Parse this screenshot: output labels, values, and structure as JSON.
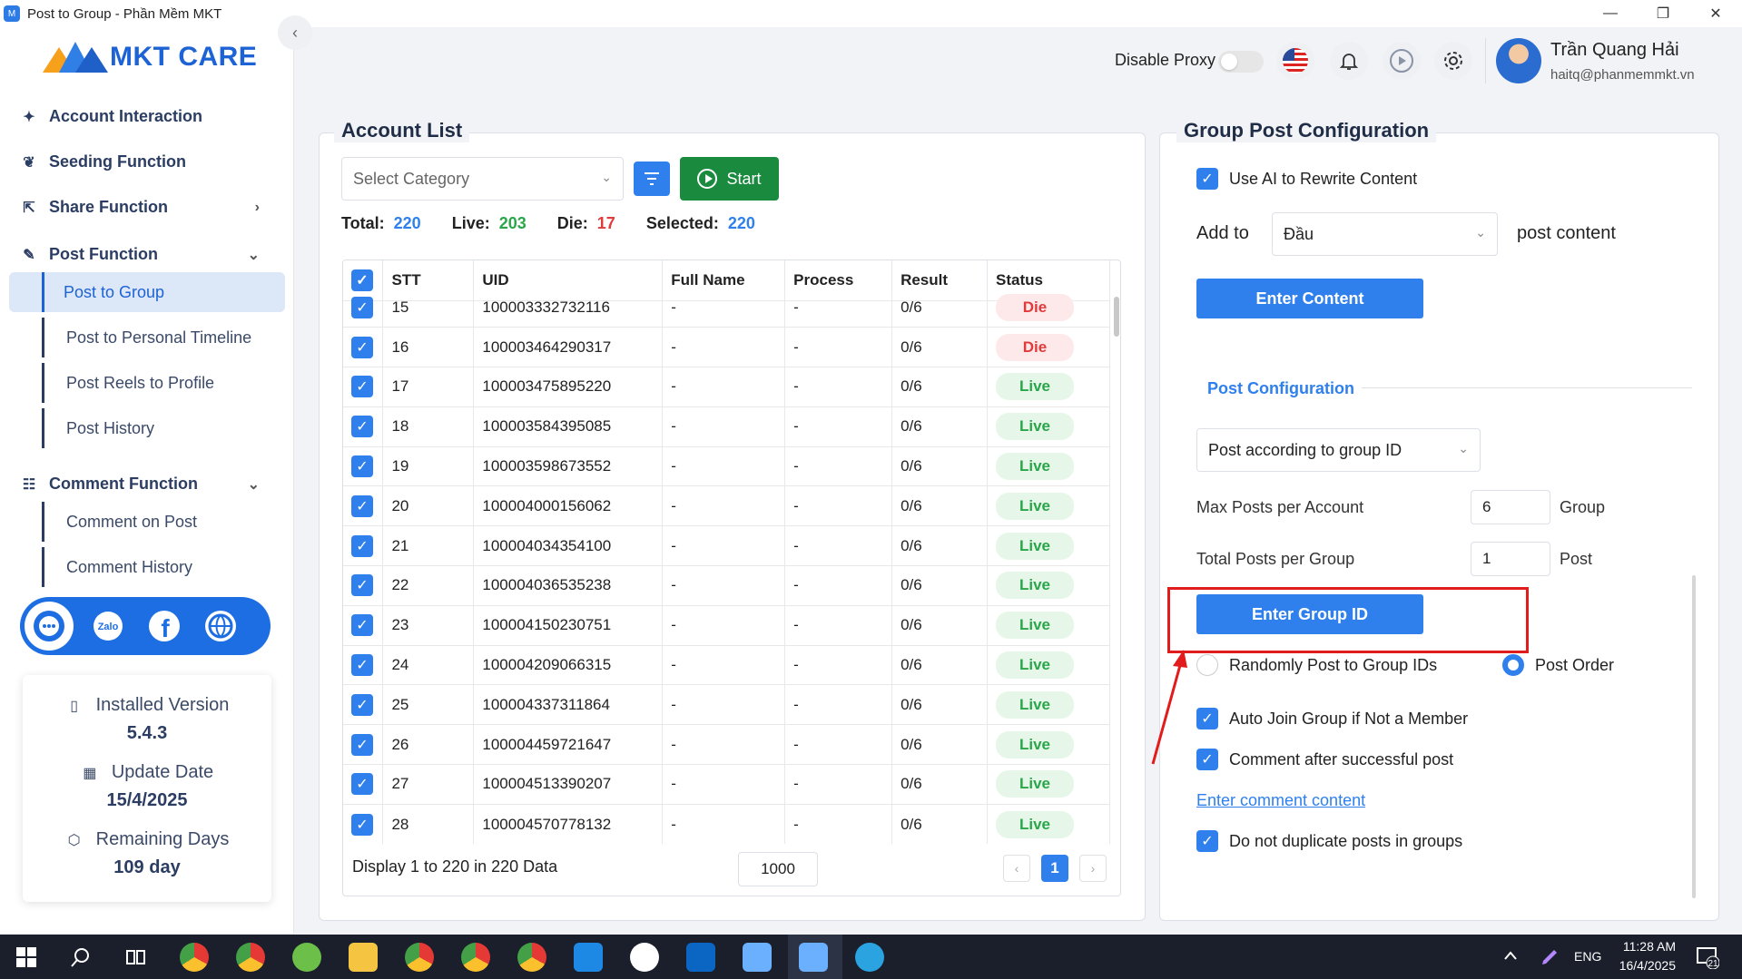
{
  "window": {
    "title": "Post to Group - Phần Mềm MKT",
    "minimize": "—",
    "maximize": "❐",
    "close": "✕",
    "app_icon_text": "M"
  },
  "logo": {
    "text": "MKT CARE"
  },
  "sidebar": {
    "collapse_icon": "‹",
    "items": [
      {
        "label": "Account Interaction",
        "icon": "sparkle-icon",
        "glyph": "✦"
      },
      {
        "label": "Seeding Function",
        "icon": "seed-icon",
        "glyph": "❦"
      },
      {
        "label": "Share Function",
        "icon": "share-icon",
        "glyph": "⇱",
        "chevron": "›"
      },
      {
        "label": "Post Function",
        "icon": "post-icon",
        "glyph": "✎",
        "chevron": "⌄"
      },
      {
        "label": "Comment Function",
        "icon": "comment-icon",
        "glyph": "☷",
        "chevron": "⌄"
      }
    ],
    "post_sub": [
      "Post to Group",
      "Post to Personal Timeline",
      "Post Reels to Profile",
      "Post History"
    ],
    "comment_sub": [
      "Comment on Post",
      "Comment History"
    ],
    "social_icons": [
      "support-icon",
      "zalo-icon",
      "facebook-icon",
      "website-icon"
    ],
    "zalo_text": "Zalo",
    "facebook_text": "f",
    "version": {
      "installed_label": "Installed Version",
      "installed_value": "5.4.3",
      "update_label": "Update Date",
      "update_value": "15/4/2025",
      "remaining_label": "Remaining Days",
      "remaining_value": "109 day"
    }
  },
  "header": {
    "proxy_label": "Disable Proxy",
    "proxy_enabled": false,
    "user_name": "Trần Quang Hải",
    "user_email": "haitq@phanmemmkt.vn"
  },
  "account_list": {
    "title": "Account List",
    "category_placeholder": "Select Category",
    "start_label": "Start",
    "stats": {
      "total_label": "Total:",
      "total": "220",
      "live_label": "Live:",
      "live": "203",
      "die_label": "Die:",
      "die": "17",
      "selected_label": "Selected:",
      "selected": "220"
    },
    "columns": [
      "STT",
      "UID",
      "Full Name",
      "Process",
      "Result",
      "Status"
    ],
    "rows": [
      {
        "stt": "15",
        "uid": "100003332732116",
        "name": "-",
        "process": "-",
        "result": "0/6",
        "status": "Die"
      },
      {
        "stt": "16",
        "uid": "100003464290317",
        "name": "-",
        "process": "-",
        "result": "0/6",
        "status": "Die"
      },
      {
        "stt": "17",
        "uid": "100003475895220",
        "name": "-",
        "process": "-",
        "result": "0/6",
        "status": "Live"
      },
      {
        "stt": "18",
        "uid": "100003584395085",
        "name": "-",
        "process": "-",
        "result": "0/6",
        "status": "Live"
      },
      {
        "stt": "19",
        "uid": "100003598673552",
        "name": "-",
        "process": "-",
        "result": "0/6",
        "status": "Live"
      },
      {
        "stt": "20",
        "uid": "100004000156062",
        "name": "-",
        "process": "-",
        "result": "0/6",
        "status": "Live"
      },
      {
        "stt": "21",
        "uid": "100004034354100",
        "name": "-",
        "process": "-",
        "result": "0/6",
        "status": "Live"
      },
      {
        "stt": "22",
        "uid": "100004036535238",
        "name": "-",
        "process": "-",
        "result": "0/6",
        "status": "Live"
      },
      {
        "stt": "23",
        "uid": "100004150230751",
        "name": "-",
        "process": "-",
        "result": "0/6",
        "status": "Live"
      },
      {
        "stt": "24",
        "uid": "100004209066315",
        "name": "-",
        "process": "-",
        "result": "0/6",
        "status": "Live"
      },
      {
        "stt": "25",
        "uid": "100004337311864",
        "name": "-",
        "process": "-",
        "result": "0/6",
        "status": "Live"
      },
      {
        "stt": "26",
        "uid": "100004459721647",
        "name": "-",
        "process": "-",
        "result": "0/6",
        "status": "Live"
      },
      {
        "stt": "27",
        "uid": "100004513390207",
        "name": "-",
        "process": "-",
        "result": "0/6",
        "status": "Live"
      },
      {
        "stt": "28",
        "uid": "100004570778132",
        "name": "-",
        "process": "-",
        "result": "0/6",
        "status": "Live"
      }
    ],
    "footer_text": "Display 1 to 220 in 220 Data",
    "page_size": "1000",
    "current_page": "1",
    "prev": "‹",
    "next": "›"
  },
  "config": {
    "title": "Group Post Configuration",
    "use_ai_label": "Use AI to Rewrite Content",
    "use_ai_checked": true,
    "add_to_label": "Add to",
    "add_to_value": "Đầu",
    "post_content_label": "post content",
    "enter_content_label": "Enter Content",
    "post_config_label": "Post Configuration",
    "post_mode_value": "Post according to group ID",
    "max_posts_label": "Max Posts per Account",
    "max_posts_value": "6",
    "max_posts_unit": "Group",
    "total_posts_label": "Total Posts per Group",
    "total_posts_value": "1",
    "total_posts_unit": "Post",
    "enter_group_id_label": "Enter Group ID",
    "random_label": "Randomly Post to Group IDs",
    "order_label": "Post Order",
    "selected_mode": "Post Order",
    "auto_join_label": "Auto Join Group if Not a Member",
    "comment_after_label": "Comment after successful post",
    "enter_comment_link": "Enter comment content",
    "no_duplicate_label": "Do not duplicate posts in groups"
  },
  "taskbar": {
    "lang": "ENG",
    "time": "11:28 AM",
    "date": "16/4/2025",
    "notif_count": "21"
  },
  "colors": {
    "accent": "#2f80ed",
    "start_green": "#1a8a3e",
    "live": "#2aa64a",
    "die": "#e03a3a",
    "highlight_box": "#e21c1c"
  }
}
